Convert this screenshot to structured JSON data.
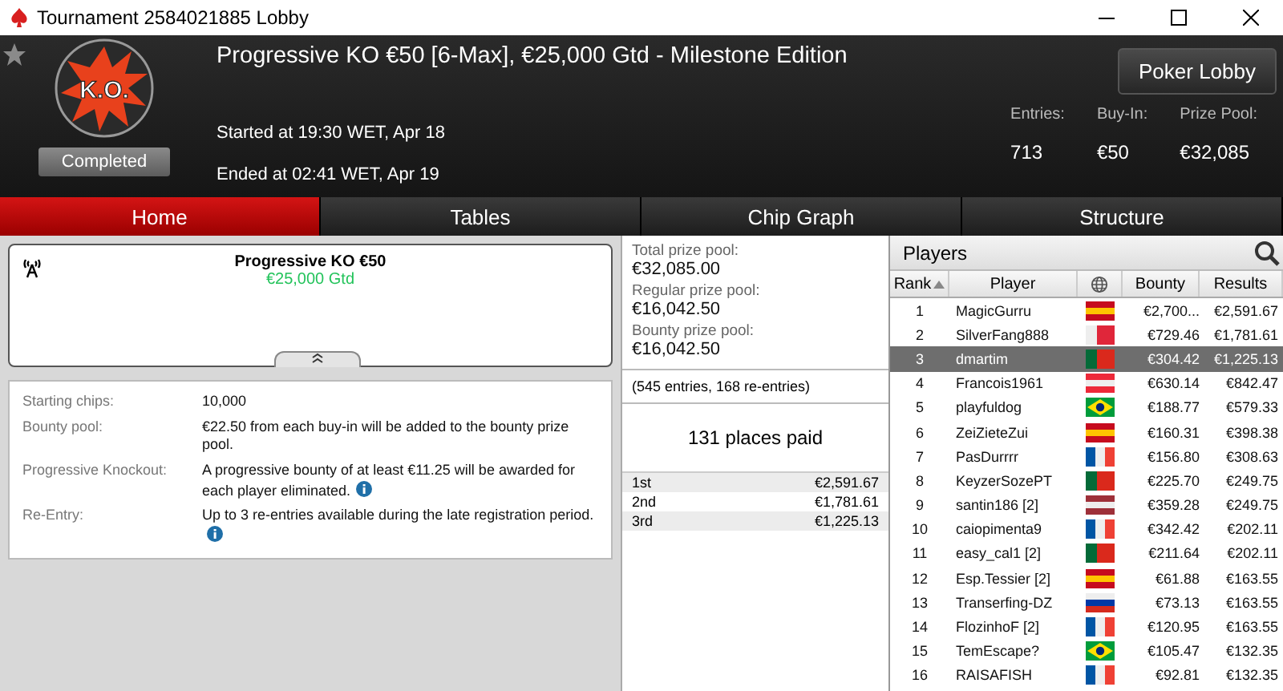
{
  "window": {
    "title": "Tournament 2584021885 Lobby"
  },
  "header": {
    "title": "Progressive KO €50 [6-Max], €25,000 Gtd - Milestone Edition",
    "logo_text": "K.O.",
    "favorite": false,
    "status": "Completed",
    "started": "Started at 19:30 WET, Apr 18",
    "ended": "Ended at 02:41 WET, Apr 19",
    "lobby_button": "Poker Lobby",
    "stats": [
      {
        "label": "Entries:",
        "value": "713"
      },
      {
        "label": "Buy-In:",
        "value": "€50"
      },
      {
        "label": "Prize Pool:",
        "value": "€32,085"
      }
    ]
  },
  "tabs": [
    {
      "label": "Home",
      "selected": true
    },
    {
      "label": "Tables",
      "selected": false
    },
    {
      "label": "Chip Graph",
      "selected": false
    },
    {
      "label": "Structure",
      "selected": false
    }
  ],
  "banner": {
    "name": "Progressive KO €50",
    "guarantee": "€25,000 Gtd"
  },
  "details": [
    {
      "label": "Starting chips:",
      "value": "10,000",
      "info": false
    },
    {
      "label": "Bounty pool:",
      "value": "€22.50 from each buy-in will be added to the bounty prize pool.",
      "info": false
    },
    {
      "label": "Progressive Knockout:",
      "value": "A progressive bounty of at least €11.25 will be awarded for each player eliminated.",
      "info": true
    },
    {
      "label": "Re-Entry:",
      "value": "Up to 3 re-entries available during the late registration period.",
      "info": true
    }
  ],
  "prizes": {
    "pools": [
      {
        "label": "Total prize pool:",
        "value": "€32,085.00"
      },
      {
        "label": "Regular prize pool:",
        "value": "€16,042.50"
      },
      {
        "label": "Bounty prize pool:",
        "value": "€16,042.50"
      }
    ],
    "entries_note": "(545 entries, 168 re-entries)",
    "places_paid": "131 places paid",
    "payouts": [
      {
        "place": "1st",
        "amount": "€2,591.67"
      },
      {
        "place": "2nd",
        "amount": "€1,781.61"
      },
      {
        "place": "3rd",
        "amount": "€1,225.13"
      }
    ]
  },
  "players": {
    "title": "Players",
    "columns": [
      "Rank",
      "Player",
      "Bounty",
      "Results"
    ],
    "rows": [
      {
        "rank": "1",
        "player": "MagicGurru",
        "kind": "spain",
        "bounty": "€2,700...",
        "result": "€2,591.67",
        "selected": false
      },
      {
        "rank": "2",
        "player": "SilverFang888",
        "kind": "malta",
        "bounty": "€729.46",
        "result": "€1,781.61",
        "selected": false
      },
      {
        "rank": "3",
        "player": "dmartim",
        "kind": "portugal",
        "bounty": "€304.42",
        "result": "€1,225.13",
        "selected": true
      },
      {
        "rank": "4",
        "player": "Francois1961",
        "kind": "austria",
        "bounty": "€630.14",
        "result": "€842.47",
        "selected": false
      },
      {
        "rank": "5",
        "player": "playfuldog",
        "kind": "brazil",
        "bounty": "€188.77",
        "result": "€579.33",
        "selected": false
      },
      {
        "rank": "6",
        "player": "ZeiZieteZui",
        "kind": "spain",
        "bounty": "€160.31",
        "result": "€398.38",
        "selected": false
      },
      {
        "rank": "7",
        "player": "PasDurrrr",
        "kind": "france",
        "bounty": "€156.80",
        "result": "€308.63",
        "selected": false
      },
      {
        "rank": "8",
        "player": "KeyzerSozePT",
        "kind": "portugal",
        "bounty": "€225.70",
        "result": "€249.75",
        "selected": false
      },
      {
        "rank": "9",
        "player": "santin186 [2]",
        "kind": "latvia",
        "bounty": "€359.28",
        "result": "€249.75",
        "selected": false
      },
      {
        "rank": "10",
        "player": "caiopimenta9",
        "kind": "france",
        "bounty": "€342.42",
        "result": "€202.11",
        "selected": false
      },
      {
        "rank": "11",
        "player": "easy_cal1 [2]",
        "kind": "portugal",
        "bounty": "€211.64",
        "result": "€202.11",
        "selected": false
      },
      {
        "rank": "12",
        "player": "Esp.Tessier [2]",
        "kind": "spain",
        "bounty": "€61.88",
        "result": "€163.55",
        "selected": false
      },
      {
        "rank": "13",
        "player": "Transerfing-DZ",
        "kind": "russia",
        "bounty": "€73.13",
        "result": "€163.55",
        "selected": false
      },
      {
        "rank": "14",
        "player": "FlozinhoF [2]",
        "kind": "france",
        "bounty": "€120.95",
        "result": "€163.55",
        "selected": false
      },
      {
        "rank": "15",
        "player": "TemEscape?",
        "kind": "brazil",
        "bounty": "€105.47",
        "result": "€132.35",
        "selected": false
      },
      {
        "rank": "16",
        "player": "RAISAFISH",
        "kind": "france",
        "bounty": "€92.81",
        "result": "€132.35",
        "selected": false
      }
    ]
  }
}
